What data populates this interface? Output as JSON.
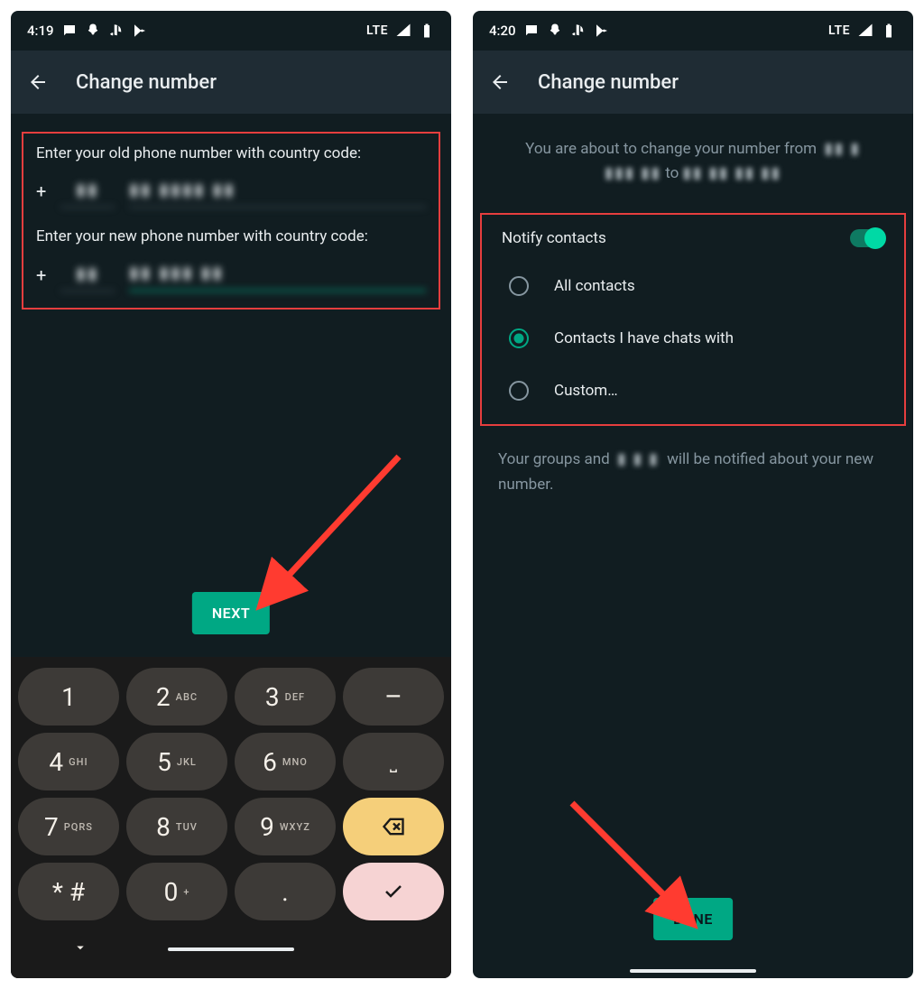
{
  "left": {
    "status": {
      "time": "4:19",
      "network": "LTE"
    },
    "appbar_title": "Change number",
    "label_old": "Enter your old phone number with country code:",
    "label_new": "Enter your new phone number with country code:",
    "next_label": "NEXT",
    "keypad": [
      [
        {
          "d": "1",
          "t": ""
        },
        {
          "d": "2",
          "t": "ABC"
        },
        {
          "d": "3",
          "t": "DEF"
        },
        {
          "d": "–",
          "t": "",
          "cls": "dash"
        }
      ],
      [
        {
          "d": "4",
          "t": "GHI"
        },
        {
          "d": "5",
          "t": "JKL"
        },
        {
          "d": "6",
          "t": "MNO"
        },
        {
          "d": "␣",
          "t": "",
          "cls": "space"
        }
      ],
      [
        {
          "d": "7",
          "t": "PQRS"
        },
        {
          "d": "8",
          "t": "TUV"
        },
        {
          "d": "9",
          "t": "WXYZ"
        },
        {
          "d": "",
          "t": "",
          "cls": "backspace"
        }
      ],
      [
        {
          "d": "* #",
          "t": ""
        },
        {
          "d": "0",
          "t": "+"
        },
        {
          "d": ".",
          "t": ""
        },
        {
          "d": "",
          "t": "",
          "cls": "enter"
        }
      ]
    ]
  },
  "right": {
    "status": {
      "time": "4:20",
      "network": "LTE"
    },
    "appbar_title": "Change number",
    "info_line1": "You are about to change your number from",
    "info_to": "to",
    "notify_label": "Notify contacts",
    "options": [
      {
        "label": "All contacts",
        "selected": false
      },
      {
        "label": "Contacts I have chats with",
        "selected": true
      },
      {
        "label": "Custom…",
        "selected": false
      }
    ],
    "note_a": "Your groups and",
    "note_b": "will be notified about your new number.",
    "done_label": "DONE"
  }
}
